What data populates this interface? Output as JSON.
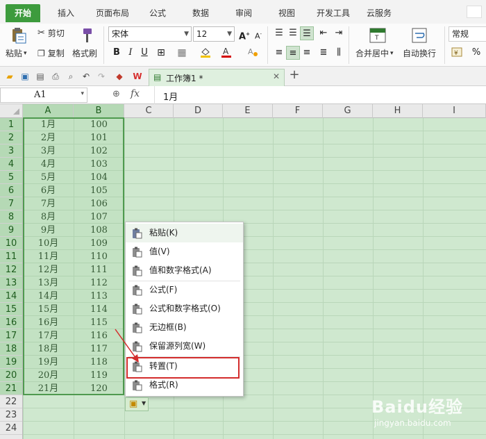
{
  "menu": {
    "tabs": [
      "开始",
      "插入",
      "页面布局",
      "公式",
      "数据",
      "审阅",
      "视图",
      "开发工具",
      "云服务"
    ],
    "active": "开始"
  },
  "ribbon": {
    "paste": "粘贴",
    "cut": "剪切",
    "copy": "复制",
    "format_painter": "格式刷",
    "font_name": "宋体",
    "font_size": "12",
    "bold": "B",
    "italic": "I",
    "underline": "U",
    "merge_center": "合并居中",
    "wrap_text": "自动换行",
    "number_format": "常规",
    "percent": "%",
    "grow_font": "A",
    "shrink_font": "A"
  },
  "quick": {
    "doc_title": "工作簿1 *",
    "new_tab": "+"
  },
  "formula": {
    "name_box": "A1",
    "fx": "fx",
    "content": "1月"
  },
  "columns": [
    "A",
    "B",
    "C",
    "D",
    "E",
    "F",
    "G",
    "H",
    "I"
  ],
  "rows": [
    "1",
    "2",
    "3",
    "4",
    "5",
    "6",
    "7",
    "8",
    "9",
    "10",
    "11",
    "12",
    "13",
    "14",
    "15",
    "16",
    "17",
    "18",
    "19",
    "20",
    "21",
    "22",
    "23",
    "24"
  ],
  "cells": {
    "colA": [
      "1月",
      "2月",
      "3月",
      "4月",
      "5月",
      "6月",
      "7月",
      "8月",
      "9月",
      "10月",
      "11月",
      "12月",
      "13月",
      "14月",
      "15月",
      "16月",
      "17月",
      "18月",
      "19月",
      "20月",
      "21月"
    ],
    "colB": [
      "100",
      "101",
      "102",
      "103",
      "104",
      "105",
      "106",
      "107",
      "108",
      "109",
      "110",
      "111",
      "112",
      "113",
      "114",
      "115",
      "116",
      "117",
      "118",
      "119",
      "120"
    ]
  },
  "context_menu": {
    "items": [
      {
        "label": "粘贴(K)",
        "icon": "paste-icon"
      },
      {
        "label": "值(V)",
        "icon": "paste-values-icon"
      },
      {
        "label": "值和数字格式(A)",
        "icon": "paste-values-numformat-icon"
      },
      {
        "label": "公式(F)",
        "icon": "paste-formula-icon"
      },
      {
        "label": "公式和数字格式(O)",
        "icon": "paste-formula-numformat-icon"
      },
      {
        "label": "无边框(B)",
        "icon": "paste-no-border-icon"
      },
      {
        "label": "保留源列宽(W)",
        "icon": "paste-keep-width-icon"
      },
      {
        "label": "转置(T)",
        "icon": "paste-transpose-icon"
      },
      {
        "label": "格式(R)",
        "icon": "paste-format-icon"
      }
    ],
    "highlighted": "转置(T)"
  },
  "watermark": {
    "brand": "Baidu经验",
    "url": "jingyan.baidu.com"
  },
  "colors": {
    "accent": "#3d9b3d",
    "grid_bg": "#cfe8cf",
    "highlight": "#d32c2c"
  }
}
